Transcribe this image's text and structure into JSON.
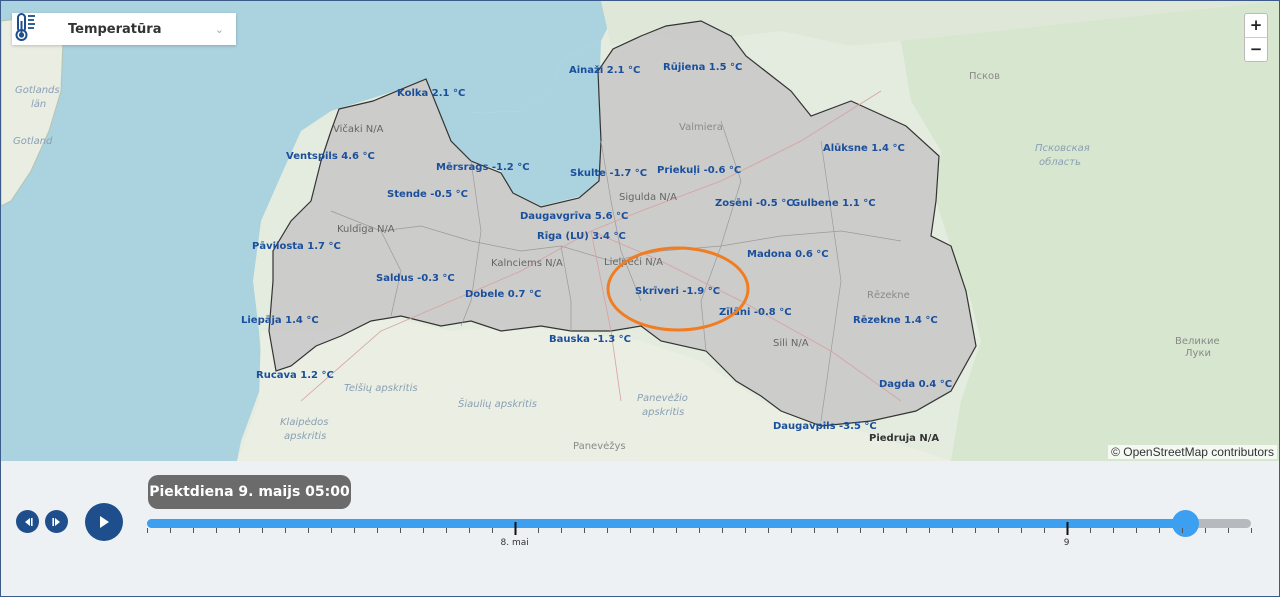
{
  "layer_selector": {
    "label": "Temperatūra",
    "icon": "thermometer-icon",
    "chevron": "⌄"
  },
  "zoom": {
    "in": "+",
    "out": "−"
  },
  "attribution": "© OpenStreetMap contributors",
  "map_labels": {
    "gotlands_1": "Gotlands",
    "gotlands_2": "län",
    "gotland": "Gotland",
    "pskov": "Псков",
    "pskov_obl_1": "Псковская",
    "pskov_obl_2": "область",
    "velikie_1": "Великие",
    "velikie_2": "Луки",
    "telsiu": "Telšių apskritis",
    "siauliu": "Šiaulių apskritis",
    "klaipedos_1": "Klaipėdos",
    "klaipedos_2": "apskritis",
    "panevezio_1": "Panevėžio",
    "panevezio_2": "apskritis",
    "panevezys": "Panevėžys",
    "valmiera": "Valmiera",
    "rezekne_city": "Rēzekne"
  },
  "stations": [
    {
      "name": "Ainaži 2.1 °C",
      "status": "value"
    },
    {
      "name": "Rūjiena 1.5 °C",
      "status": "value"
    },
    {
      "name": "Kolka 2.1 °C",
      "status": "value"
    },
    {
      "name": "Vičaki N/A",
      "status": "na"
    },
    {
      "name": "Ventspils 4.6 °C",
      "status": "value"
    },
    {
      "name": "Mērsrags -1.2 °C",
      "status": "value"
    },
    {
      "name": "Skulte -1.7 °C",
      "status": "value"
    },
    {
      "name": "Priekuļi -0.6 °C",
      "status": "value"
    },
    {
      "name": "Alūksne 1.4 °C",
      "status": "value"
    },
    {
      "name": "Stende -0.5 °C",
      "status": "value"
    },
    {
      "name": "Sigulda N/A",
      "status": "na"
    },
    {
      "name": "Zosēni -0.5 °C",
      "status": "value"
    },
    {
      "name": "Gulbene 1.1 °C",
      "status": "value"
    },
    {
      "name": "Daugavgrīva 5.6 °C",
      "status": "value"
    },
    {
      "name": "Kuldīga N/A",
      "status": "na"
    },
    {
      "name": "Rīga (LU) 3.4 °C",
      "status": "value"
    },
    {
      "name": "Pāvilosta 1.7 °C",
      "status": "value"
    },
    {
      "name": "Madona 0.6 °C",
      "status": "value"
    },
    {
      "name": "Lielpeči N/A",
      "status": "na"
    },
    {
      "name": "Kalnciems N/A",
      "status": "na"
    },
    {
      "name": "Saldus -0.3 °C",
      "status": "value"
    },
    {
      "name": "Skrīveri -1.9 °C",
      "status": "value"
    },
    {
      "name": "Dobele 0.7 °C",
      "status": "value"
    },
    {
      "name": "Zīlāni -0.8 °C",
      "status": "value"
    },
    {
      "name": "Rēzekne 1.4 °C",
      "status": "value"
    },
    {
      "name": "Liepāja 1.4 °C",
      "status": "value"
    },
    {
      "name": "Bauska -1.3 °C",
      "status": "value"
    },
    {
      "name": "Sili N/A",
      "status": "na"
    },
    {
      "name": "Rucava 1.2 °C",
      "status": "value"
    },
    {
      "name": "Dagda 0.4 °C",
      "status": "value"
    },
    {
      "name": "Daugavpils -3.5 °C",
      "status": "value"
    },
    {
      "name": "Piedruja N/A",
      "status": "na"
    }
  ],
  "highlight": {
    "station": "Skrīveri -1.9 °C",
    "color": "#f07d22"
  },
  "colors": {
    "water": "#aad3df",
    "country_fill": "#c9c9c9",
    "label": "#1a4f9c",
    "accent": "#3d9ff0",
    "button": "#1e4f8c"
  },
  "timeline": {
    "current_label": "Piektdiena 9. maijs 05:00",
    "progress": 0.94,
    "major_ticks": [
      {
        "label": "8. mai",
        "fraction": 0.333
      },
      {
        "label": "9",
        "fraction": 0.833
      }
    ],
    "minor_tick_count": 48
  },
  "controls": {
    "prev": "step-back",
    "next": "step-forward",
    "play": "play"
  }
}
